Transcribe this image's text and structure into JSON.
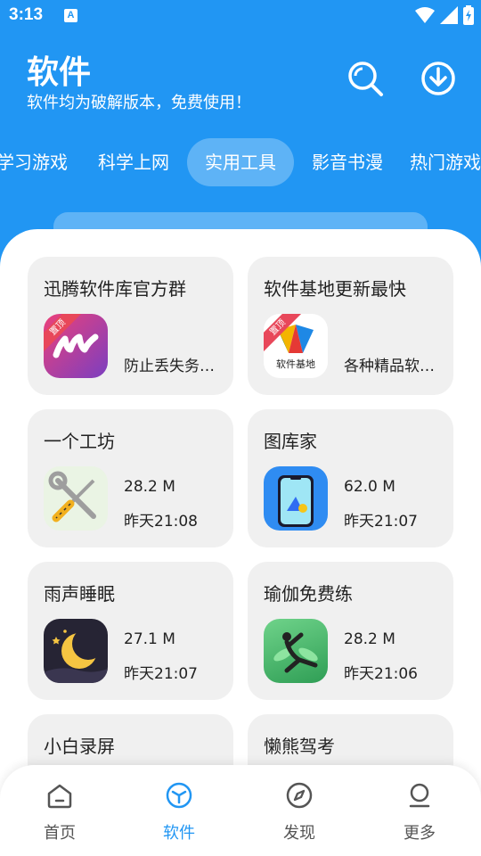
{
  "status": {
    "time": "3:13",
    "notif_icon": "font-a-icon"
  },
  "header": {
    "title": "软件",
    "subtitle": "软件均为破解版本，免费使用！",
    "search_icon": "search-icon",
    "download_icon": "download-icon"
  },
  "tabs": [
    {
      "label": "学习游戏",
      "active": false
    },
    {
      "label": "科学上网",
      "active": false
    },
    {
      "label": "实用工具",
      "active": true
    },
    {
      "label": "影音书漫",
      "active": false
    },
    {
      "label": "热门游戏",
      "active": false
    }
  ],
  "cards": [
    {
      "title": "迅腾软件库官方群",
      "desc": "防止丢失务…",
      "pinned": true,
      "pin_label": "置顶",
      "icon": "m-logo-icon"
    },
    {
      "title": "软件基地更新最快",
      "desc": "各种精品软…",
      "pinned": true,
      "pin_label": "置顶",
      "icon": "software-base-icon",
      "icon_text": "软件基地"
    },
    {
      "title": "一个工坊",
      "size": "28.2 M",
      "date": "昨天21:08",
      "icon": "tools-icon"
    },
    {
      "title": "图库家",
      "size": "62.0 M",
      "date": "昨天21:07",
      "icon": "gallery-phone-icon"
    },
    {
      "title": "雨声睡眠",
      "size": "27.1 M",
      "date": "昨天21:07",
      "icon": "moon-icon"
    },
    {
      "title": "瑜伽免费练",
      "size": "28.2 M",
      "date": "昨天21:06",
      "icon": "yoga-icon"
    },
    {
      "title": "小白录屏"
    },
    {
      "title": "懒熊驾考"
    }
  ],
  "bottom_nav": [
    {
      "label": "首页",
      "icon": "home-icon",
      "active": false
    },
    {
      "label": "软件",
      "icon": "software-cube-icon",
      "active": true
    },
    {
      "label": "发现",
      "icon": "compass-icon",
      "active": false
    },
    {
      "label": "更多",
      "icon": "profile-icon",
      "active": false
    }
  ],
  "colors": {
    "primary": "#2196f3",
    "card_bg": "#f0f0f0",
    "pin_ribbon": "#e8475a"
  }
}
